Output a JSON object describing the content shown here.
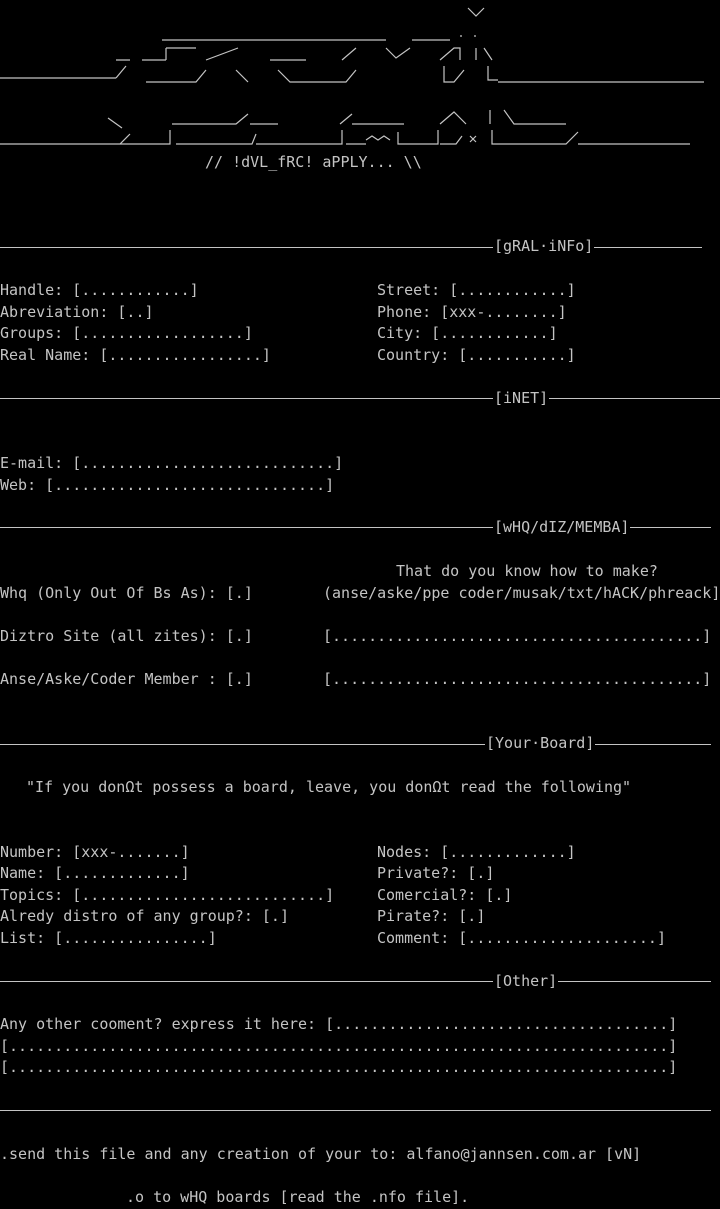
{
  "banner": {
    "tagline": "// !dVL_fRC! aPPLY... \\\\"
  },
  "sections": {
    "general": "[gRAL·iNFo]",
    "inet": "[iNET]",
    "whq": "[wHQ/dIZ/MEMBA]",
    "board": "[Your·Board]",
    "other": "[Other]"
  },
  "general": {
    "handle": "Handle: [............]",
    "abreviation": "Abreviation: [..]",
    "groups": "Groups: [..................]",
    "real_name": "Real Name: [.................]",
    "street": "Street: [............]",
    "phone": "Phone: [xxx-........]",
    "city": "City: [............]",
    "country": "Country: [...........]"
  },
  "inet": {
    "email": "E-mail: [............................]",
    "web": "Web: [..............................]"
  },
  "whq": {
    "question": "That do you know how to make?",
    "whq": "Whq (Only Out Of Bs As): [.]",
    "options": "(anse/aske/ppe coder/musak/txt/hACK/phreack]",
    "diztro": "Diztro Site (all zites): [.]",
    "answer1": "[.........................................]",
    "member": "Anse/Aske/Coder Member : [.]",
    "answer2": "[.........................................]"
  },
  "board": {
    "notice": "\"If you donΩt possess a board, leave, you donΩt read the following\"",
    "number": "Number: [xxx-.......]",
    "name": "Name: [.............]",
    "topics": "Topics: [...........................]",
    "distro": "Alredy distro of any group?: [.]",
    "list": "List: [................]",
    "nodes": "Nodes: [.............]",
    "private": "Private?: [.]",
    "comercial": "Comercial?: [.]",
    "pirate": "Pirate?: [.]",
    "comment": "Comment: [.....................]"
  },
  "other": {
    "comment_prompt": "Any other cooment? express it here: [.....................................]",
    "line2": "[.........................................................................]",
    "line3": "[.........................................................................]"
  },
  "footer": {
    "send": ".send this file and any creation of your to: alfano@jannsen.com.ar [vN]",
    "boards": ".o to wHQ boards [read the .nfo file]."
  }
}
